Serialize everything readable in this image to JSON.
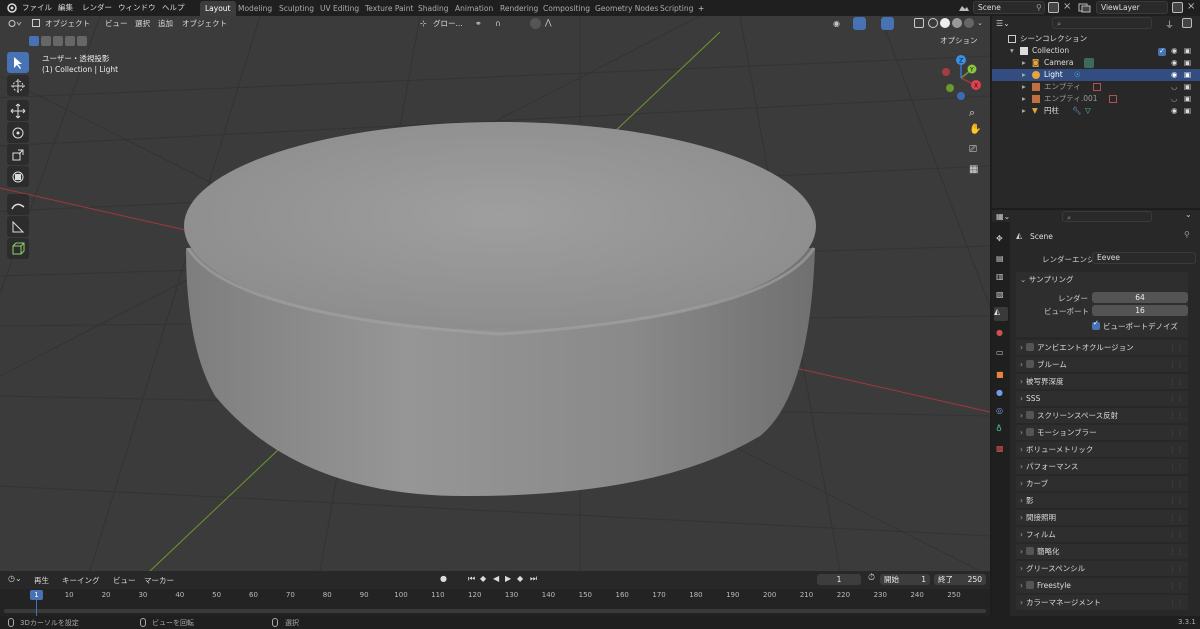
{
  "menubar": {
    "items": [
      "ファイル",
      "編集",
      "レンダー",
      "ウィンドウ",
      "ヘルプ"
    ]
  },
  "workspaces": {
    "tabs": [
      "Layout",
      "Modeling",
      "Sculpting",
      "UV Editing",
      "Texture Paint",
      "Shading",
      "Animation",
      "Rendering",
      "Compositing",
      "Geometry Nodes",
      "Scripting"
    ],
    "active": "Layout",
    "add": "+"
  },
  "scene": {
    "name": "Scene"
  },
  "viewlayer": {
    "name": "ViewLayer"
  },
  "viewport": {
    "mode": "オブジェクト",
    "menus": [
      "ビュー",
      "選択",
      "追加",
      "オブジェクト"
    ],
    "transform": "グロー...",
    "options": "オプション",
    "view_name": "ユーザー・透視投影",
    "context": "(1) Collection | Light"
  },
  "outliner": {
    "title": "シーンコレクション",
    "rows": [
      {
        "label": "Collection"
      },
      {
        "label": "Camera"
      },
      {
        "label": "Light"
      },
      {
        "label": "エンプティ"
      },
      {
        "label": "エンプティ.001"
      },
      {
        "label": "円柱"
      }
    ]
  },
  "properties": {
    "scene_label": "Scene",
    "engine_label": "レンダーエンジン",
    "engine_value": "Eevee",
    "sampling": {
      "title": "サンプリング",
      "render_label": "レンダー",
      "render_value": "64",
      "viewport_label": "ビューポート",
      "viewport_value": "16",
      "denoise_label": "ビューポートデノイズ"
    },
    "sections": [
      {
        "label": "アンビエントオクルージョン",
        "checkbox": true
      },
      {
        "label": "ブルーム",
        "checkbox": true
      },
      {
        "label": "被写界深度",
        "checkbox": false
      },
      {
        "label": "SSS",
        "checkbox": false
      },
      {
        "label": "スクリーンスペース反射",
        "checkbox": true
      },
      {
        "label": "モーションブラー",
        "checkbox": true
      },
      {
        "label": "ボリューメトリック",
        "checkbox": false
      },
      {
        "label": "パフォーマンス",
        "checkbox": false
      },
      {
        "label": "カーブ",
        "checkbox": false
      },
      {
        "label": "影",
        "checkbox": false
      },
      {
        "label": "間接照明",
        "checkbox": false
      },
      {
        "label": "フィルム",
        "checkbox": false
      },
      {
        "label": "簡略化",
        "checkbox": true
      },
      {
        "label": "グリースペンシル",
        "checkbox": false
      },
      {
        "label": "Freestyle",
        "checkbox": true
      },
      {
        "label": "カラーマネージメント",
        "checkbox": false
      }
    ]
  },
  "timeline": {
    "menus": [
      "再生",
      "キーイング",
      "ビュー",
      "マーカー"
    ],
    "current_frame": "1",
    "start_label": "開始",
    "start_value": "1",
    "end_label": "終了",
    "end_value": "250",
    "playhead": "1",
    "ticks": [
      "10",
      "20",
      "30",
      "40",
      "50",
      "60",
      "70",
      "80",
      "90",
      "100",
      "110",
      "120",
      "130",
      "140",
      "150",
      "160",
      "170",
      "180",
      "190",
      "200",
      "210",
      "220",
      "230",
      "240",
      "250"
    ]
  },
  "statusbar": {
    "items": [
      "3Dカーソルを設定",
      "ビューを回転",
      "選択"
    ],
    "version": "3.3.1"
  },
  "colors": {
    "accent": "#4772b3",
    "header": "#303030",
    "viewport_bg": "#3b3b3b",
    "x_axis": "#a0383e",
    "y_axis": "#6a9a2c",
    "selected_row": "#334d80"
  }
}
